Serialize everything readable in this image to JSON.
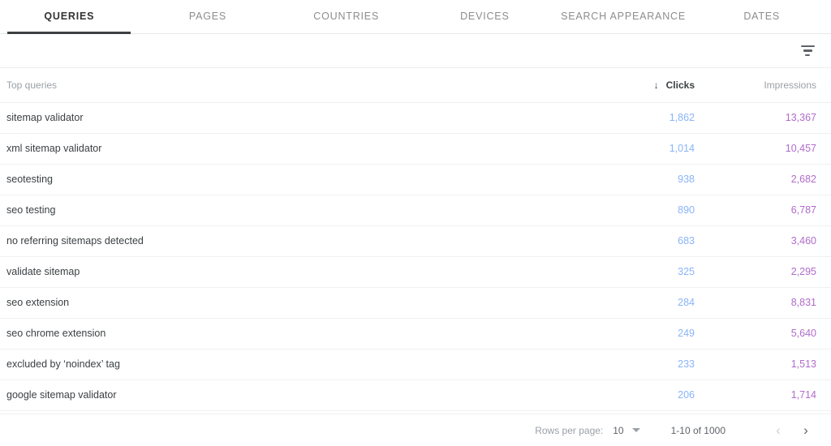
{
  "tabs": [
    {
      "label": "QUERIES",
      "active": true
    },
    {
      "label": "PAGES",
      "active": false
    },
    {
      "label": "COUNTRIES",
      "active": false
    },
    {
      "label": "DEVICES",
      "active": false
    },
    {
      "label": "SEARCH APPEARANCE",
      "active": false
    },
    {
      "label": "DATES",
      "active": false
    }
  ],
  "toolbar": {
    "filter_icon": "filter-list-icon"
  },
  "table": {
    "columns": {
      "query": "Top queries",
      "clicks": "Clicks",
      "impressions": "Impressions"
    },
    "sort": {
      "column": "Clicks",
      "direction": "desc",
      "arrow": "↓"
    },
    "rows": [
      {
        "query": "sitemap validator",
        "clicks": "1,862",
        "impressions": "13,367"
      },
      {
        "query": "xml sitemap validator",
        "clicks": "1,014",
        "impressions": "10,457"
      },
      {
        "query": "seotesting",
        "clicks": "938",
        "impressions": "2,682"
      },
      {
        "query": "seo testing",
        "clicks": "890",
        "impressions": "6,787"
      },
      {
        "query": "no referring sitemaps detected",
        "clicks": "683",
        "impressions": "3,460"
      },
      {
        "query": "validate sitemap",
        "clicks": "325",
        "impressions": "2,295"
      },
      {
        "query": "seo extension",
        "clicks": "284",
        "impressions": "8,831"
      },
      {
        "query": "seo chrome extension",
        "clicks": "249",
        "impressions": "5,640"
      },
      {
        "query": "excluded by ‘noindex’ tag",
        "clicks": "233",
        "impressions": "1,513"
      },
      {
        "query": "google sitemap validator",
        "clicks": "206",
        "impressions": "1,714"
      }
    ]
  },
  "pagination": {
    "rows_per_page_label": "Rows per page:",
    "rows_per_page_value": "10",
    "range_label": "1-10 of 1000",
    "prev_glyph": "‹",
    "next_glyph": "›"
  },
  "colors": {
    "clicks": "#8ab4f8",
    "impressions": "#b06ccb",
    "active_tab": "#3c4043",
    "inactive_tab": "#8d8d8d"
  }
}
